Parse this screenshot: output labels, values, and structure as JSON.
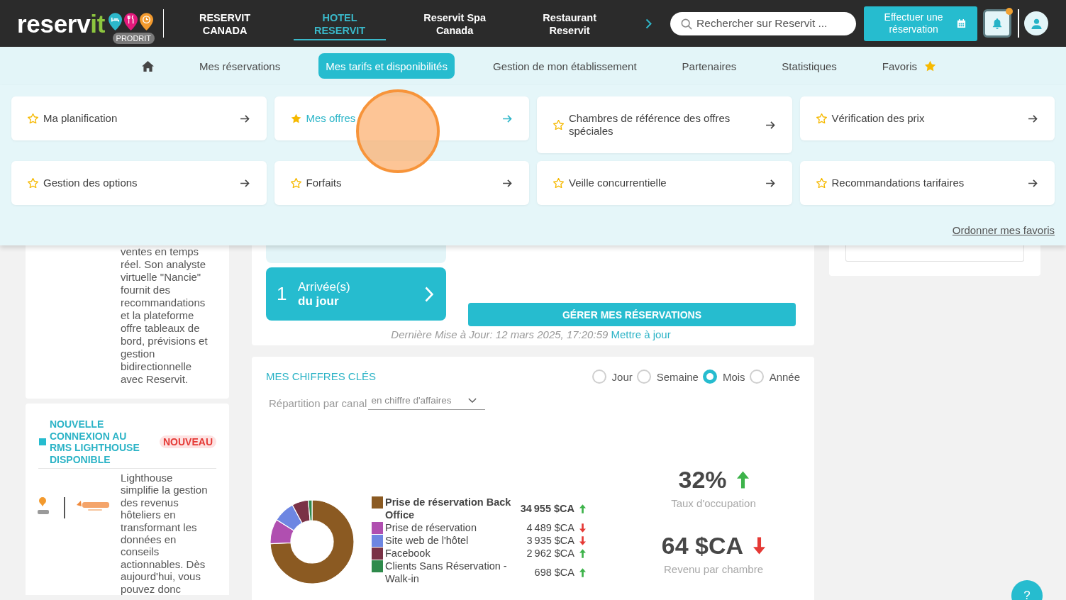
{
  "header": {
    "logo": {
      "wordmark": "reserv",
      "wordmark_accent": "it",
      "badge": "PRODRIT"
    },
    "nav": [
      {
        "label": "RESERVIT CANADA",
        "selected": false
      },
      {
        "label": "HOTEL RESERVIT",
        "selected": true
      },
      {
        "label": "Reservit Spa Canada",
        "selected": false
      },
      {
        "label": "Restaurant Reservit",
        "selected": false
      }
    ],
    "search": {
      "placeholder": "Rechercher sur Reservit ..."
    },
    "book_button": "Effectuer une réservation",
    "notifications": {
      "unread": true
    }
  },
  "subnav": [
    {
      "kind": "home",
      "selected": false
    },
    {
      "kind": "link",
      "label": "Mes réservations",
      "selected": false
    },
    {
      "kind": "link",
      "label": "Mes tarifs et disponibilités",
      "selected": true
    },
    {
      "kind": "link",
      "label": "Gestion de mon établissement",
      "selected": false
    },
    {
      "kind": "link",
      "label": "Partenaires",
      "selected": false
    },
    {
      "kind": "link",
      "label": "Statistiques",
      "selected": false
    },
    {
      "kind": "favorites",
      "label": "Favoris",
      "selected": false
    }
  ],
  "mega_menu": {
    "cards": [
      {
        "label": "Ma planification",
        "favorite": false,
        "selected": false
      },
      {
        "label": "Mes offres",
        "favorite": true,
        "selected": true
      },
      {
        "label": "Chambres de référence des offres spéciales",
        "favorite": false,
        "selected": false
      },
      {
        "label": "Vérification des prix",
        "favorite": false,
        "selected": false
      },
      {
        "label": "Gestion des options",
        "favorite": false,
        "selected": false
      },
      {
        "label": "Forfaits",
        "favorite": false,
        "selected": false
      },
      {
        "label": "Veille concurrentielle",
        "favorite": false,
        "selected": false
      },
      {
        "label": "Recommandations tarifaires",
        "favorite": false,
        "selected": false
      }
    ],
    "reorder_link": "Ordonner mes favoris"
  },
  "news": [
    {
      "body": "ventes en temps réel. Son analyste virtuelle \"Nancie\" fournit des recommandations et la plateforme offre tableaux de bord, prévisions et gestion bidirectionnelle avec Reservit."
    },
    {
      "title": "NOUVELLE CONNEXION AU RMS LIGHTHOUSE DISPONIBLE",
      "badge": "NOUVEAU",
      "body": "Lighthouse simplifie la gestion des revenus hôteliers en transformant les données en conseils actionnables. Dès aujourd'hui, vous pouvez donc"
    }
  ],
  "reservations": {
    "arrivals": {
      "count": "1",
      "label": "Arrivée(s)",
      "sublabel": "du jour"
    },
    "manage_button": "GÉRER MES RÉSERVATIONS",
    "last_update": "Dernière Mise à Jour: 12 mars 2025, 17:20:59",
    "refresh_link": "Mettre à jour"
  },
  "key_figures": {
    "title": "MES CHIFFRES CLÉS",
    "periods": [
      {
        "label": "Jour",
        "selected": false
      },
      {
        "label": "Semaine",
        "selected": false
      },
      {
        "label": "Mois",
        "selected": true
      },
      {
        "label": "Année",
        "selected": false
      }
    ],
    "breakdown": {
      "label": "Répartition par canal",
      "value": "en chiffre d'affaires"
    },
    "chart_data": {
      "type": "donut",
      "categories": [
        "Prise de réservation Back Office",
        "Prise de réservation",
        "Site web de l'hôtel",
        "Facebook",
        "Clients Sans Réservation - Walk-in"
      ],
      "values": [
        74.31,
        9.54,
        8.37,
        6.3,
        1.48
      ]
    },
    "legend": [
      {
        "color": "#8b5a22",
        "value": "34 955 $CA",
        "rising": true,
        "highlighted": true
      },
      {
        "color": "#b04fb0",
        "value": "4 489 $CA",
        "rising": false,
        "highlighted": false
      },
      {
        "color": "#6e86e2",
        "value": "3 935 $CA",
        "rising": false,
        "highlighted": false
      },
      {
        "color": "#7a3246",
        "value": "2 962 $CA",
        "rising": true,
        "highlighted": false
      },
      {
        "color": "#2e8a4b",
        "value": "698 $CA",
        "rising": true,
        "highlighted": false
      }
    ],
    "kpis": [
      {
        "value": "32%",
        "label": "Taux d'occupation",
        "rising": true
      },
      {
        "value": "64 $CA",
        "label": "Revenu par chambre",
        "rising": false
      }
    ]
  },
  "help_button": "?"
}
